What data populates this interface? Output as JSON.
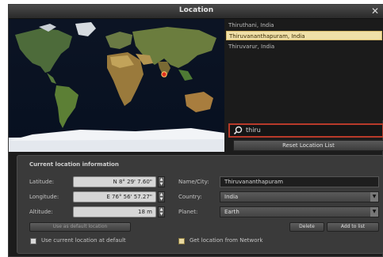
{
  "window": {
    "title": "Location",
    "close_glyph": "✕"
  },
  "cities": [
    {
      "label": "Thiruthani, India",
      "selected": false
    },
    {
      "label": "Thiruvananthapuram, India",
      "selected": true
    },
    {
      "label": "Thiruvarur, India",
      "selected": false
    }
  ],
  "search": {
    "value": "thiru",
    "icon": "search-icon"
  },
  "reset_list_label": "Reset Location List",
  "info": {
    "section_title": "Current location information",
    "latitude_label": "Latitude:",
    "latitude_value": "N 8° 29' 7.60\"",
    "longitude_label": "Longitude:",
    "longitude_value": "E 76° 56' 57.27\"",
    "altitude_label": "Altitude:",
    "altitude_value": "18 m",
    "name_label": "Name/City:",
    "name_value": "Thiruvananthapuram",
    "country_label": "Country:",
    "country_value": "India",
    "planet_label": "Planet:",
    "planet_value": "Earth",
    "use_default_button": "Use as default location",
    "delete_button": "Delete",
    "add_button": "Add to list",
    "use_current_checkbox": "Use current location at default",
    "use_current_checked": false,
    "network_checkbox": "Get location from Network",
    "network_checked": true
  },
  "colors": {
    "selected_row": "#f0e0a8",
    "search_border": "#b83a2a",
    "map_marker": "#e03020",
    "ocean": "#0a1630"
  }
}
